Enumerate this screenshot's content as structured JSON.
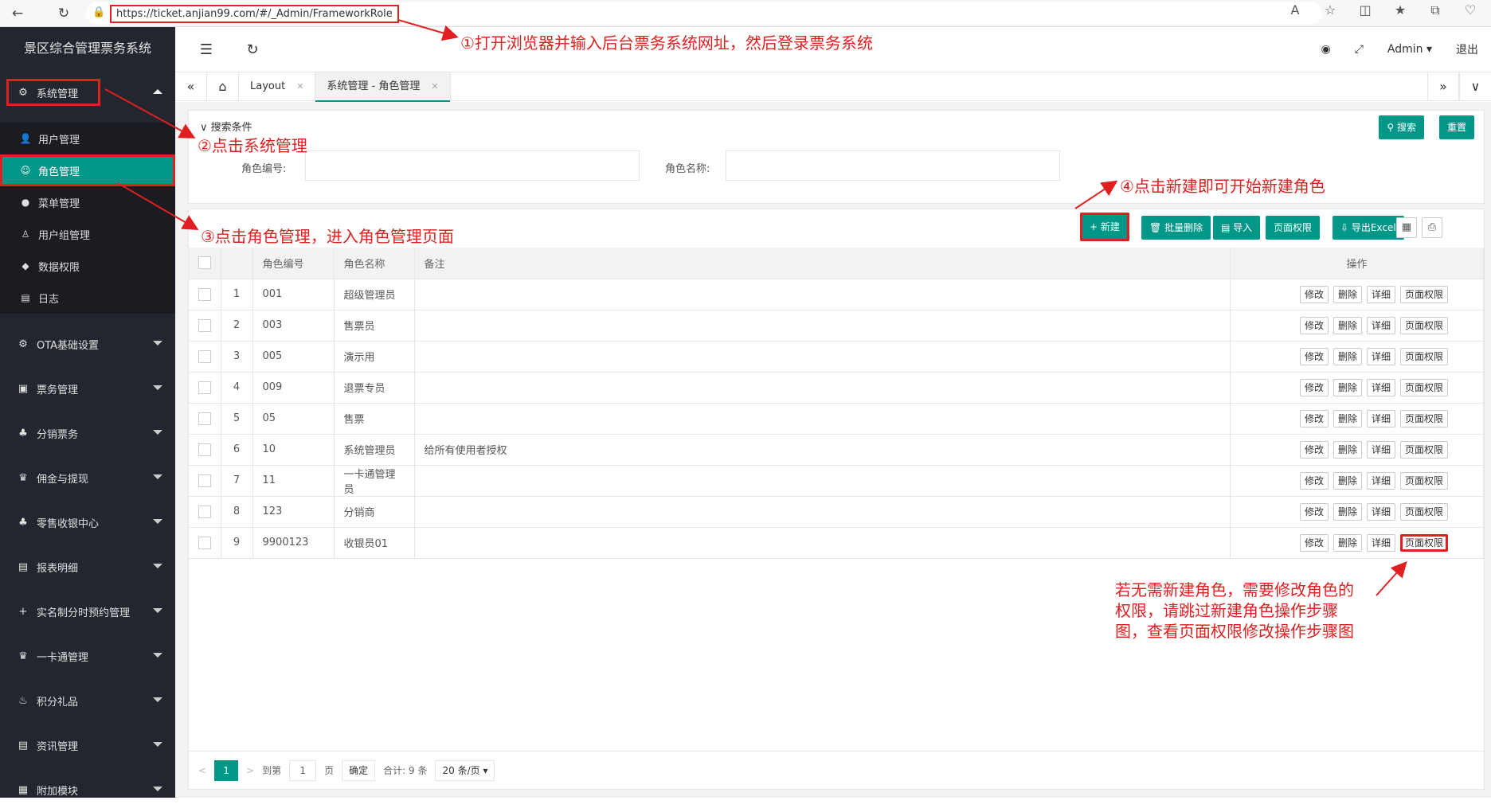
{
  "browser": {
    "url": "https://ticket.anjian99.com/#/_Admin/FrameworkRole"
  },
  "sidebar": {
    "title": "景区综合管理票务系统",
    "system_menu": "系统管理",
    "sub_items": [
      {
        "label": "用户管理",
        "icon": "user-icon"
      },
      {
        "label": "角色管理",
        "icon": "role-icon"
      },
      {
        "label": "菜单管理",
        "icon": "menu-icon"
      },
      {
        "label": "用户组管理",
        "icon": "usergroup-icon"
      },
      {
        "label": "数据权限",
        "icon": "shield-icon"
      },
      {
        "label": "日志",
        "icon": "log-icon"
      }
    ],
    "menus": [
      {
        "label": "OTA基础设置",
        "icon": "gear-icon"
      },
      {
        "label": "票务管理",
        "icon": "ticket-icon"
      },
      {
        "label": "分销票务",
        "icon": "distribution-icon"
      },
      {
        "label": "佣金与提现",
        "icon": "commission-icon"
      },
      {
        "label": "零售收银中心",
        "icon": "cashier-icon"
      },
      {
        "label": "报表明细",
        "icon": "report-icon"
      },
      {
        "label": "实名制分时预约管理",
        "icon": "plus-icon"
      },
      {
        "label": "一卡通管理",
        "icon": "card-icon"
      },
      {
        "label": "积分礼品",
        "icon": "gift-icon"
      },
      {
        "label": "资讯管理",
        "icon": "news-icon"
      },
      {
        "label": "附加模块",
        "icon": "module-icon"
      }
    ]
  },
  "topbar": {
    "user": "Admin",
    "logout": "退出"
  },
  "tabs": [
    {
      "label": "Layout"
    },
    {
      "label": "系统管理 - 角色管理"
    }
  ],
  "search": {
    "title": "搜索条件",
    "search_btn": "搜索",
    "reset_btn": "重置",
    "role_code_label": "角色编号:",
    "role_name_label": "角色名称:"
  },
  "toolbar": {
    "new": "新建",
    "batch_delete": "批量删除",
    "import": "导入",
    "page_perm": "页面权限",
    "export": "导出Excel"
  },
  "table": {
    "headers": [
      "角色编号",
      "角色名称",
      "备注",
      "操作"
    ],
    "op_labels": [
      "修改",
      "删除",
      "详细",
      "页面权限"
    ],
    "rows": [
      {
        "idx": "1",
        "code": "001",
        "name": "超级管理员",
        "remark": ""
      },
      {
        "idx": "2",
        "code": "003",
        "name": "售票员",
        "remark": ""
      },
      {
        "idx": "3",
        "code": "005",
        "name": "演示用",
        "remark": ""
      },
      {
        "idx": "4",
        "code": "009",
        "name": "退票专员",
        "remark": ""
      },
      {
        "idx": "5",
        "code": "05",
        "name": "售票",
        "remark": ""
      },
      {
        "idx": "6",
        "code": "10",
        "name": "系统管理员",
        "remark": "给所有使用者授权"
      },
      {
        "idx": "7",
        "code": "11",
        "name": "一卡通管理员",
        "remark": ""
      },
      {
        "idx": "8",
        "code": "123",
        "name": "分销商",
        "remark": ""
      },
      {
        "idx": "9",
        "code": "9900123",
        "name": "收银员01",
        "remark": ""
      }
    ]
  },
  "pager": {
    "current": "1",
    "goto": "到第",
    "page_input": "1",
    "page_unit": "页",
    "confirm": "确定",
    "total": "合计: 9 条",
    "page_size": "20 条/页"
  },
  "annotations": {
    "step1": "①打开浏览器并输入后台票务系统网址，然后登录票务系统",
    "step2": "②点击系统管理",
    "step3": "③点击角色管理，进入角色管理页面",
    "step4": "④点击新建即可开始新建角色",
    "note_line1": "若无需新建角色，需要修改角色的",
    "note_line2": "权限，请跳过新建角色操作步骤",
    "note_line3": "图，查看页面权限修改操作步骤图"
  },
  "colors": {
    "accent": "#009688",
    "sidebar": "#23262e",
    "annotation": "#e02020"
  }
}
